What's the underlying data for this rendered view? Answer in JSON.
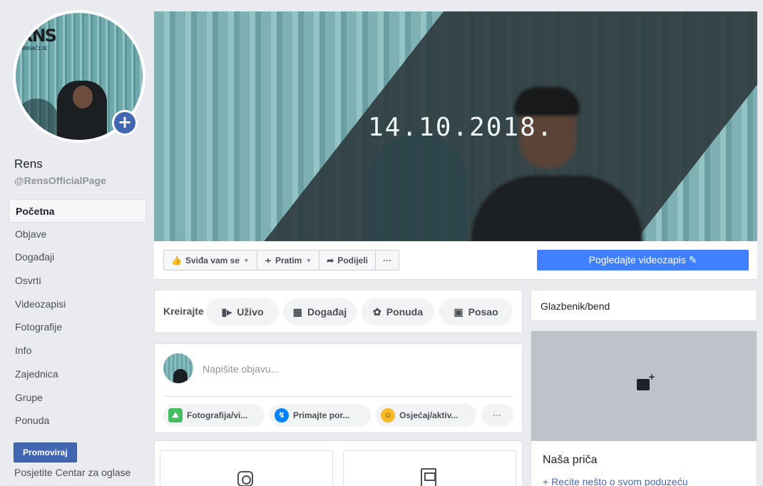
{
  "profile": {
    "name": "Rens",
    "handle": "@RensOfficialPage",
    "logo_text": "RNS",
    "logo_sub": "DRUGAČIJE"
  },
  "nav": {
    "items": [
      {
        "label": "Početna"
      },
      {
        "label": "Objave"
      },
      {
        "label": "Događaji"
      },
      {
        "label": "Osvrti"
      },
      {
        "label": "Videozapisi"
      },
      {
        "label": "Fotografije"
      },
      {
        "label": "Info"
      },
      {
        "label": "Zajednica"
      },
      {
        "label": "Grupe"
      },
      {
        "label": "Ponuda"
      }
    ],
    "promote": "Promoviraj",
    "ads_center": "Posjetite Centar za oglase"
  },
  "cover": {
    "date_text": "14.10.2018."
  },
  "actions": {
    "like": "Sviđa vam se",
    "follow": "Pratim",
    "share": "Podijeli",
    "more": "···",
    "watch_video": "Pogledajte videozapis"
  },
  "create": {
    "label": "Kreirajte",
    "live": "Uživo",
    "event": "Događaj",
    "offer": "Ponuda",
    "job": "Posao"
  },
  "composer": {
    "placeholder": "Napišite objavu...",
    "photo": "Fotografija/vi...",
    "messages": "Primajte por...",
    "feeling": "Osjećaj/aktiv...",
    "more": "···"
  },
  "sidebar": {
    "category": "Glazbenik/bend",
    "story_title": "Naša priča",
    "story_link": "+ Recite nešto o svom poduzeću"
  },
  "colors": {
    "facebook_blue": "#4267b2",
    "watch_button": "#4080ff"
  }
}
